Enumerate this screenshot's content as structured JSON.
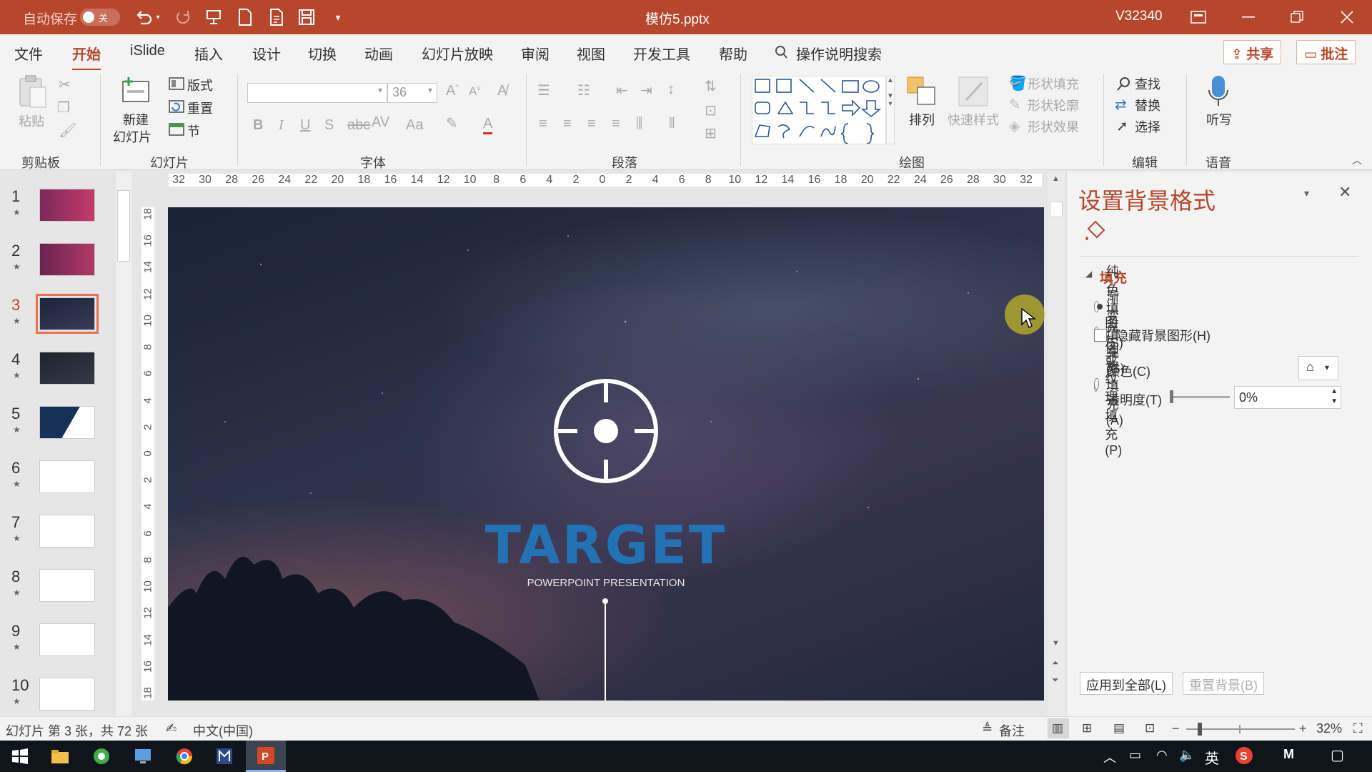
{
  "titlebar": {
    "autosave_label": "自动保存",
    "autosave_state": "关",
    "file_name": "模仿5.pptx",
    "user": "V32340"
  },
  "menu": {
    "tabs": [
      "文件",
      "开始",
      "iSlide",
      "插入",
      "设计",
      "切换",
      "动画",
      "幻灯片放映",
      "审阅",
      "视图",
      "开发工具",
      "帮助"
    ],
    "search": "操作说明搜索",
    "share": "共享",
    "comment": "批注"
  },
  "ribbon": {
    "clipboard": {
      "paste": "粘贴",
      "group": "剪贴板"
    },
    "slides": {
      "new_slide_line1": "新建",
      "new_slide_line2": "幻灯片",
      "layout": "版式",
      "reset": "重置",
      "section": "节",
      "group": "幻灯片"
    },
    "font": {
      "size": "36",
      "group": "字体"
    },
    "paragraph": {
      "group": "段落"
    },
    "drawing": {
      "arrange": "排列",
      "quick_styles": "快速样式",
      "shape_fill": "形状填充",
      "shape_outline": "形状轮廓",
      "shape_effects": "形状效果",
      "group": "绘图"
    },
    "editing": {
      "find": "查找",
      "replace": "替换",
      "select": "选择",
      "group": "编辑"
    },
    "voice": {
      "dictate": "听写",
      "group": "语音"
    }
  },
  "ruler": {
    "marks": [
      "32",
      "30",
      "28",
      "26",
      "24",
      "22",
      "20",
      "18",
      "16",
      "14",
      "12",
      "10",
      "8",
      "6",
      "4",
      "2",
      "0",
      "2",
      "4",
      "6",
      "8",
      "10",
      "12",
      "14",
      "16",
      "18",
      "20",
      "22",
      "24",
      "26",
      "28",
      "30",
      "32"
    ],
    "vmarks": [
      "18",
      "16",
      "14",
      "12",
      "10",
      "8",
      "6",
      "4",
      "2",
      "0",
      "2",
      "4",
      "6",
      "8",
      "10",
      "12",
      "14",
      "16",
      "18"
    ]
  },
  "thumbnails": {
    "items": [
      "1",
      "2",
      "3",
      "4",
      "5",
      "6",
      "7",
      "8",
      "9",
      "10"
    ],
    "selected_index": 2
  },
  "slide": {
    "title": "TARGET",
    "subtitle": "POWERPOINT PRESENTATION"
  },
  "format_pane": {
    "title": "设置背景格式",
    "section": "填充",
    "options": [
      "纯色填充(S)",
      "渐变填充(G)",
      "图片或纹理填充(P)",
      "图案填充(A)"
    ],
    "selected_option": 0,
    "hide_bg": "隐藏背景图形(H)",
    "color_label": "颜色(C)",
    "transparency_label": "透明度(T)",
    "transparency_value": "0%",
    "transparency_level": 0,
    "apply_all": "应用到全部(L)",
    "reset_bg": "重置背景(B)"
  },
  "statusbar": {
    "slide_info": "幻灯片 第 3 张，共 72 张",
    "language": "中文(中国)",
    "notes": "备注",
    "zoom": "32%",
    "zoom_level": 0.32
  },
  "taskbar": {
    "ime": "英"
  },
  "colors": {
    "accent": "#b7472a",
    "slide_title": "#2372b5"
  }
}
